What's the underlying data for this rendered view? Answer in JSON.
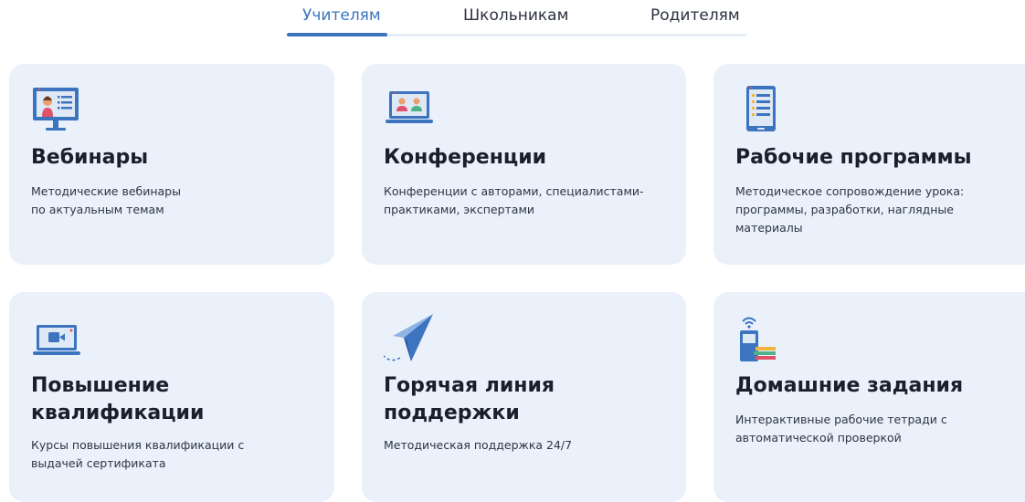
{
  "tabs": [
    {
      "label": "Учителям",
      "active": true
    },
    {
      "label": "Школьникам",
      "active": false
    },
    {
      "label": "Родителям",
      "active": false
    }
  ],
  "cards": [
    {
      "icon": "teacher-monitor-icon",
      "title": "Вебинары",
      "description": "Методические вебинары\nпо актуальным темам"
    },
    {
      "icon": "laptop-people-icon",
      "title": "Конференции",
      "description": "Конференции с авторами, специалистами-\nпрактиками, экспертами"
    },
    {
      "icon": "tablet-document-icon",
      "title": "Рабочие программы",
      "description": "Методическое сопровождение урока:\nпрограммы, разработки, наглядные\nматериалы"
    },
    {
      "icon": "video-laptop-icon",
      "title": "Повышение\nквалификации",
      "description": "Курсы повышения квалификации с\nвыдачей сертификата"
    },
    {
      "icon": "paper-plane-icon",
      "title": "Горячая линия\nподдержки",
      "description": "Методическая поддержка 24/7"
    },
    {
      "icon": "digital-workbook-icon",
      "title": "Домашние задания",
      "description": "Интерактивные рабочие тетради с\nавтоматической проверкой"
    }
  ],
  "colors": {
    "accent": "#3c74bf",
    "card_bg": "#eaf1fb",
    "text": "#1a1f2b"
  }
}
